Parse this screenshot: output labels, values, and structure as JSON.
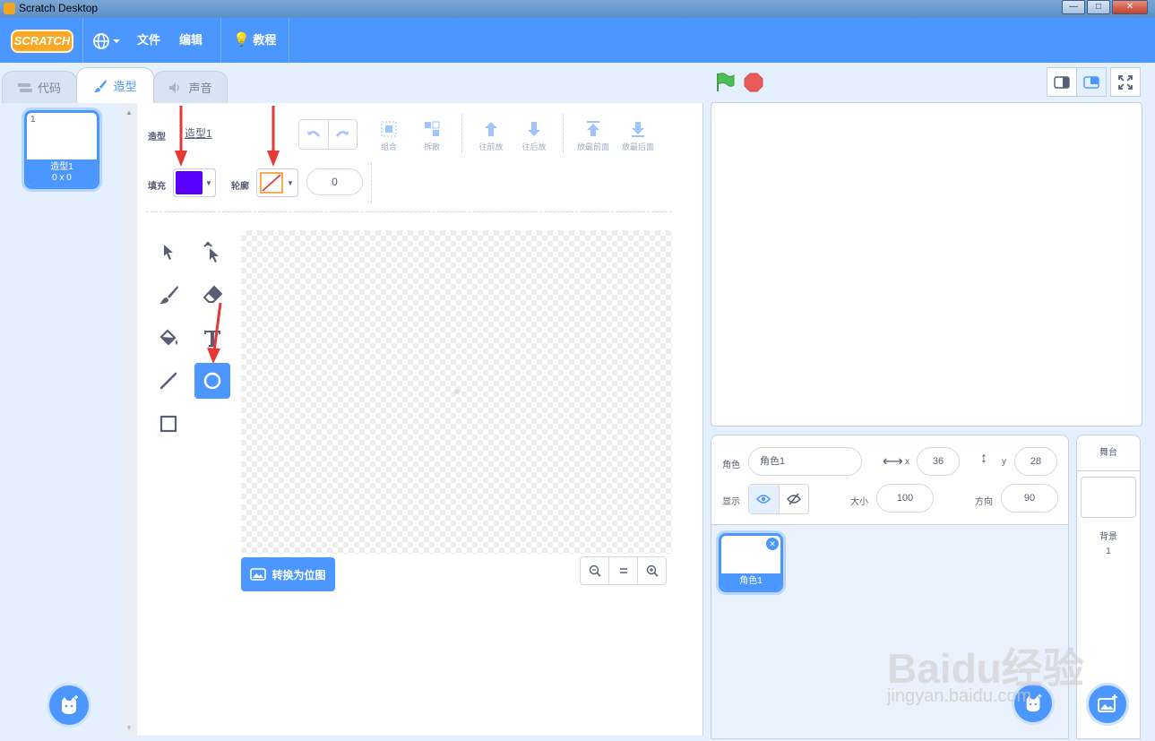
{
  "window": {
    "title": "Scratch Desktop",
    "controls": [
      "—",
      "□",
      "✕"
    ]
  },
  "menubar": {
    "logo": "SCRATCH",
    "file": "文件",
    "edit": "编辑",
    "tutorials": "教程"
  },
  "tabs": {
    "code": "代码",
    "costumes": "造型",
    "sounds": "声音"
  },
  "costume_list": {
    "items": [
      {
        "number": "1",
        "name": "造型1",
        "size": "0 x 0"
      }
    ]
  },
  "paint_editor": {
    "costume_label": "造型",
    "costume_name": "造型1",
    "toolbar": {
      "group": "组合",
      "ungroup": "拆散",
      "forward": "往前放",
      "backward": "往后放",
      "front": "放最前面",
      "back": "放最后面"
    },
    "fill_label": "填充",
    "fill_color": "#5a00ff",
    "outline_label": "轮廓",
    "outline_width": "0",
    "convert_button": "转换为位图"
  },
  "sprite_info": {
    "sprite_label": "角色",
    "sprite_name": "角色1",
    "x_label": "x",
    "x_value": "36",
    "y_label": "y",
    "y_value": "28",
    "show_label": "显示",
    "size_label": "大小",
    "size_value": "100",
    "direction_label": "方向",
    "direction_value": "90"
  },
  "sprite_list": {
    "items": [
      {
        "name": "角色1"
      }
    ]
  },
  "stage_selector": {
    "title": "舞台",
    "backdrops_label": "背景",
    "backdrop_count": "1"
  },
  "watermark": {
    "brand": "Baidu经验",
    "url": "jingyan.baidu.com"
  },
  "colors": {
    "accent": "#4c97ff",
    "arrow": "#e53935",
    "flag": "#4cbf56",
    "stop": "#ec5959"
  }
}
